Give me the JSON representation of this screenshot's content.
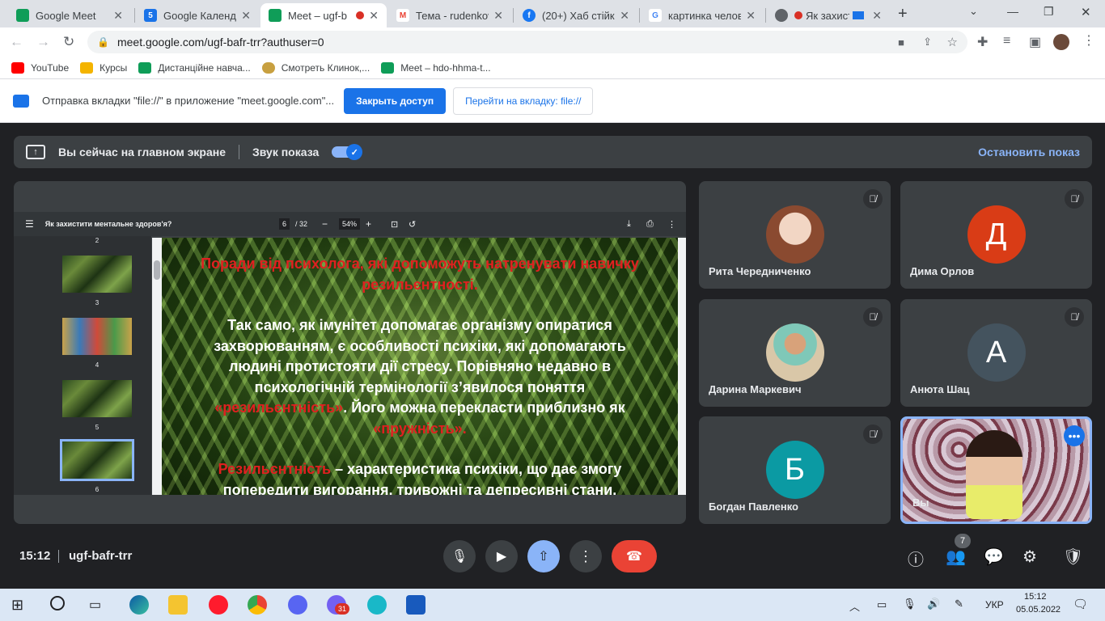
{
  "tabs": [
    {
      "title": "Google Meet",
      "color": "#0f9d58"
    },
    {
      "title": "Google Календар",
      "color": "#1a73e8",
      "badge": "5"
    },
    {
      "title": "Meet – ugf-b",
      "color": "#0f9d58"
    },
    {
      "title": "Тема - rudenkov",
      "color": "#ea4335"
    },
    {
      "title": "(20+) Хаб стійко",
      "color": "#1877f2"
    },
    {
      "title": "картинка челове",
      "color": "#4285f4"
    },
    {
      "title": "Як захист",
      "color": "#5f6368"
    }
  ],
  "address": "meet.google.com/ugf-bafr-trr?authuser=0",
  "bookmarks": [
    {
      "label": "YouTube",
      "color": "#ff0000"
    },
    {
      "label": "Курсы",
      "color": "#f4b400"
    },
    {
      "label": "Дистанційне навча...",
      "color": "#0f9d58"
    },
    {
      "label": "Смотреть Клинок,...",
      "color": "#c8a040"
    },
    {
      "label": "Meet – hdo-hhma-t...",
      "color": "#0f9d58"
    }
  ],
  "infobar": {
    "text": "Отправка вкладки \"file://\" в приложение \"meet.google.com\"...",
    "close_access": "Закрыть доступ",
    "goto_tab": "Перейти на вкладку: file://"
  },
  "presbar": {
    "main_screen": "Вы сейчас на главном экране",
    "sound": "Звук показа",
    "stop": "Остановить показ"
  },
  "pdf": {
    "title": "Як захистити ментальне здоров'я?",
    "page": "6",
    "total": "/ 32",
    "zoom": "54%",
    "thumbs": [
      "2",
      "3",
      "4",
      "5",
      "6"
    ],
    "slide": {
      "heading": "Поради від психолога, які допоможуть натренувати навичку резильєнтності.",
      "p1_a": "Так само, як імунітет допомагає організму опиратися захворюванням, є особливості психіки, які допомагають людині протистояти дії стресу. Порівняно недавно в психологічній термінології з’явилося поняття ",
      "p1_red1": "«резильєнтність»",
      "p1_b": ". Його можна перекласти приблизно як ",
      "p1_red2": "«пружність».",
      "p2_red": "Резильєнтність",
      "p2_b": " – характеристика психіки, що дає змогу попередити вигорання, тривожні та депресивні стани."
    }
  },
  "participants": [
    {
      "name": "Рита Чередниченко",
      "initial": "",
      "color": "#c98b6a"
    },
    {
      "name": "Дима Орлов",
      "initial": "Д",
      "color": "#d93c16"
    },
    {
      "name": "Дарина Маркевич",
      "initial": "",
      "color": "#b58a5c"
    },
    {
      "name": "Анюта Шац",
      "initial": "A",
      "color": "#44535e"
    },
    {
      "name": "Богдан Павленко",
      "initial": "Б",
      "color": "#0b9aa3"
    },
    {
      "name": "Вы",
      "initial": "",
      "color": "#8a6a7a"
    }
  ],
  "meeting": {
    "time": "15:12",
    "code": "ugf-bafr-trr",
    "people_count": "7"
  },
  "system": {
    "lang": "УКР",
    "time": "15:12",
    "date": "05.05.2022",
    "viber_badge": "31"
  }
}
